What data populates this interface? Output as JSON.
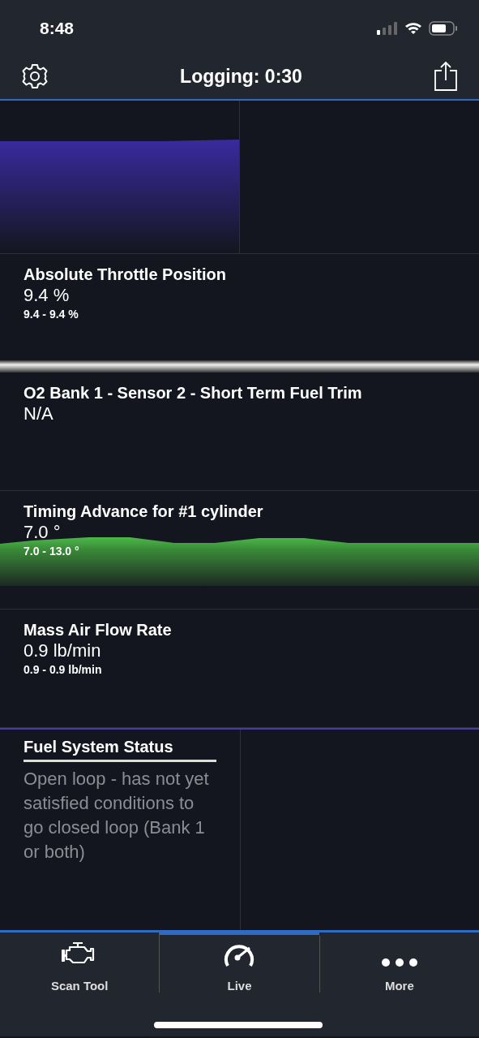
{
  "status_bar": {
    "time": "8:48"
  },
  "header": {
    "title": "Logging:  0:30"
  },
  "top_row": [
    {
      "kind": "graph",
      "color": "#3a2a9e"
    },
    {
      "kind": "empty"
    }
  ],
  "gauges": [
    {
      "name": "Absolute Throttle Position",
      "value": "9.4 %",
      "range": "9.4 - 9.4 %",
      "divider_after": true
    },
    {
      "name": "O2 Bank 1 - Sensor 2 - Short Term Fuel Trim",
      "value": "N/A",
      "divider_after": false
    },
    {
      "name": "Timing Advance for #1 cylinder",
      "value": "7.0 °",
      "range": "7.0 - 13.0 °",
      "kind": "graph",
      "divider_after": false
    },
    {
      "name": "Mass Air Flow Rate",
      "value": "0.9 lb/min",
      "range": "0.9 - 0.9 lb/min",
      "divider_after": false
    }
  ],
  "bottom_row": [
    {
      "kind": "text",
      "name": "Fuel System Status",
      "value": "Open loop - has not yet satisfied conditions to go closed loop (Bank 1 or both)"
    },
    {
      "kind": "empty"
    }
  ],
  "tabs": [
    {
      "label": "Scan Tool",
      "selected": false
    },
    {
      "label": "Live",
      "selected": true
    },
    {
      "label": "More",
      "selected": false
    }
  ]
}
